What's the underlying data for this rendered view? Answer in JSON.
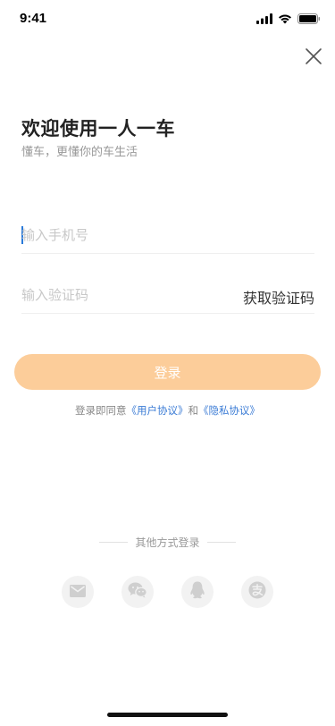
{
  "status_bar": {
    "time": "9:41",
    "icons": [
      "cellular-signal-icon",
      "wifi-icon",
      "battery-icon"
    ]
  },
  "header": {
    "close_icon": "close-icon"
  },
  "welcome": {
    "title": "欢迎使用一人一车",
    "subtitle": "懂车，更懂你的车生活"
  },
  "form": {
    "phone_placeholder": "输入手机号",
    "phone_value": "",
    "code_placeholder": "输入验证码",
    "code_value": "",
    "get_code_label": "获取验证码"
  },
  "login_button": {
    "label": "登录",
    "color": "#fccd9a"
  },
  "agreement": {
    "prefix": "登录即同意",
    "user_agreement": "《用户协议》",
    "conjunction": "和",
    "privacy_policy": "《隐私协议》",
    "link_color": "#3a7bd5"
  },
  "other_login": {
    "label": "其他方式登录",
    "methods": [
      "mail-icon",
      "wechat-icon",
      "qq-icon",
      "alipay-icon"
    ]
  },
  "colors": {
    "accent": "#fccd9a",
    "link": "#3a7bd5",
    "caret": "#2a7ad9"
  }
}
